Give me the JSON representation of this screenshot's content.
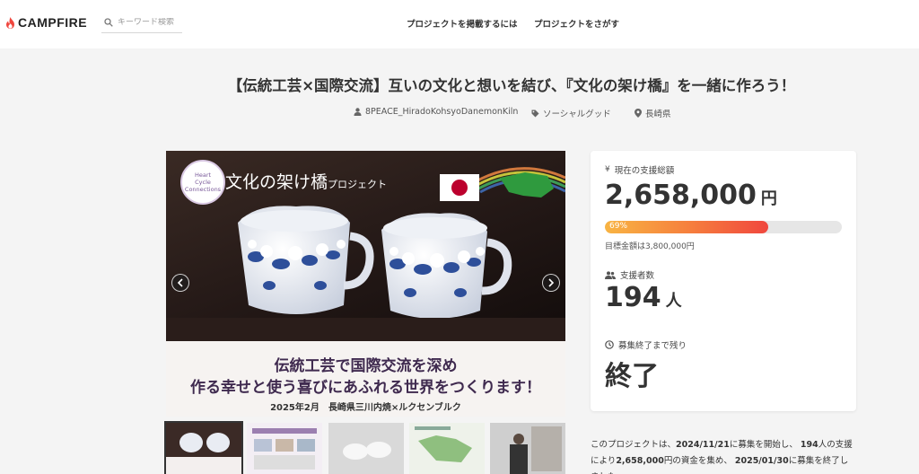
{
  "header": {
    "logo_text": "CAMPFIRE",
    "search_placeholder": "キーワード検索",
    "nav": [
      {
        "label": "プロジェクトを掲載するには"
      },
      {
        "label": "プロジェクトをさがす"
      }
    ]
  },
  "project": {
    "title": "【伝統工芸×国際交流】互いの文化と想いを結び、『文化の架け橋』を一緒に作ろう！",
    "owner": "8PEACE_HiradoKohsyoDanemonKiln",
    "category": "ソーシャルグッド",
    "location": "長崎県"
  },
  "hero": {
    "badge_lines": [
      "Heart",
      "Cycle",
      "Connections"
    ],
    "heading": "文化の架け橋",
    "heading_suffix": "プロジェクト",
    "banner_line1": "伝統工芸で国際交流を深め",
    "banner_line2": "作る幸せと使う喜びにあふれる世界をつくります！",
    "banner_line3": "2025年2月　長崎県三川内焼×ルクセンブルク"
  },
  "stats": {
    "total_label": "現在の支援総額",
    "total_amount": "2,658,000",
    "total_unit": "円",
    "progress_text": "69%",
    "progress_value": 0.69,
    "goal_text": "目標金額は3,800,000円",
    "backers_label": "支援者数",
    "backers_count": "194",
    "backers_unit": "人",
    "remaining_label": "募集終了まで残り",
    "remaining_value": "終了"
  },
  "summary": {
    "p1": "このプロジェクトは、",
    "start_date": "2024/11/21",
    "p2": "に募集を開始し、",
    "backers": "194",
    "p3": "人の支援により",
    "amount": "2,658,000",
    "p4": "円の資金を集め、",
    "end_date": "2025/01/30",
    "p5": "に募集を終了しました"
  },
  "colors": {
    "brand": "#f0473e",
    "progress_start": "#f8b443",
    "progress_end": "#f0473e",
    "text": "#333333"
  }
}
